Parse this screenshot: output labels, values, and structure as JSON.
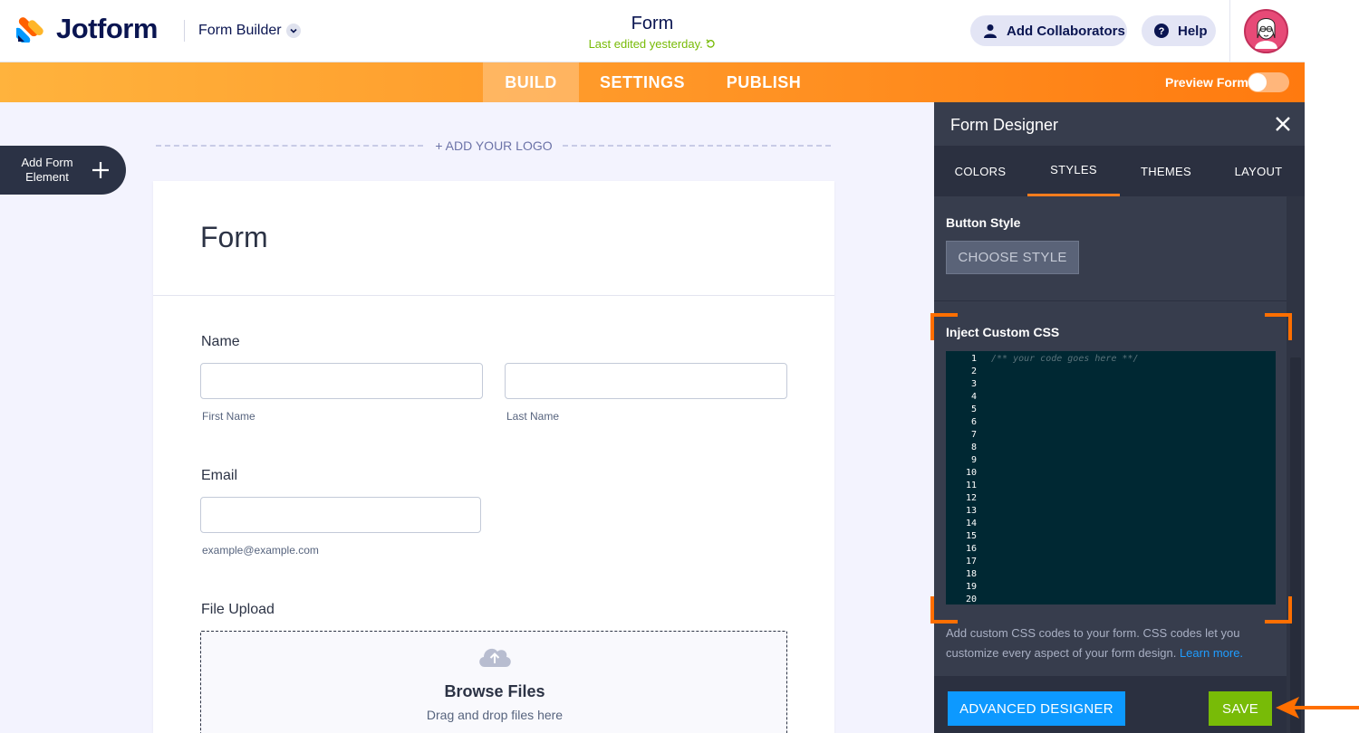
{
  "header": {
    "brand": "Jotform",
    "builder_label": "Form Builder",
    "form_title": "Form",
    "last_edited": "Last edited yesterday.",
    "add_collaborators": "Add Collaborators",
    "help": "Help"
  },
  "nav": {
    "tabs": [
      "BUILD",
      "SETTINGS",
      "PUBLISH"
    ],
    "active_tab": "BUILD",
    "preview_label": "Preview Form"
  },
  "canvas": {
    "add_element_label": "Add Form Element",
    "add_logo": "+ ADD YOUR LOGO",
    "form_heading": "Form",
    "fields": {
      "name_label": "Name",
      "first_name_sub": "First Name",
      "last_name_sub": "Last Name",
      "email_label": "Email",
      "email_sub": "example@example.com",
      "upload_label": "File Upload",
      "browse_files": "Browse Files",
      "drag_drop": "Drag and drop files here"
    }
  },
  "designer": {
    "title": "Form Designer",
    "tabs": [
      "COLORS",
      "STYLES",
      "THEMES",
      "LAYOUT"
    ],
    "active_tab": "STYLES",
    "button_style_label": "Button Style",
    "choose_style": "CHOOSE STYLE",
    "inject_css_label": "Inject Custom CSS",
    "code_placeholder": "/** your code goes here **/",
    "line_numbers": [
      "1",
      "2",
      "3",
      "4",
      "5",
      "6",
      "7",
      "8",
      "9",
      "10",
      "11",
      "12",
      "13",
      "14",
      "15",
      "16",
      "17",
      "18",
      "19",
      "20"
    ],
    "description": "Add custom CSS codes to your form. CSS codes let you customize every aspect of your form design. ",
    "learn_more": "Learn more.",
    "advanced_designer": "ADVANCED DESIGNER",
    "save": "SAVE"
  },
  "colors": {
    "accent_orange": "#ff7d1d",
    "save_green": "#78bb07",
    "link_blue": "#0d99ff",
    "panel_bg": "#373d4d",
    "editor_bg": "#002833"
  }
}
